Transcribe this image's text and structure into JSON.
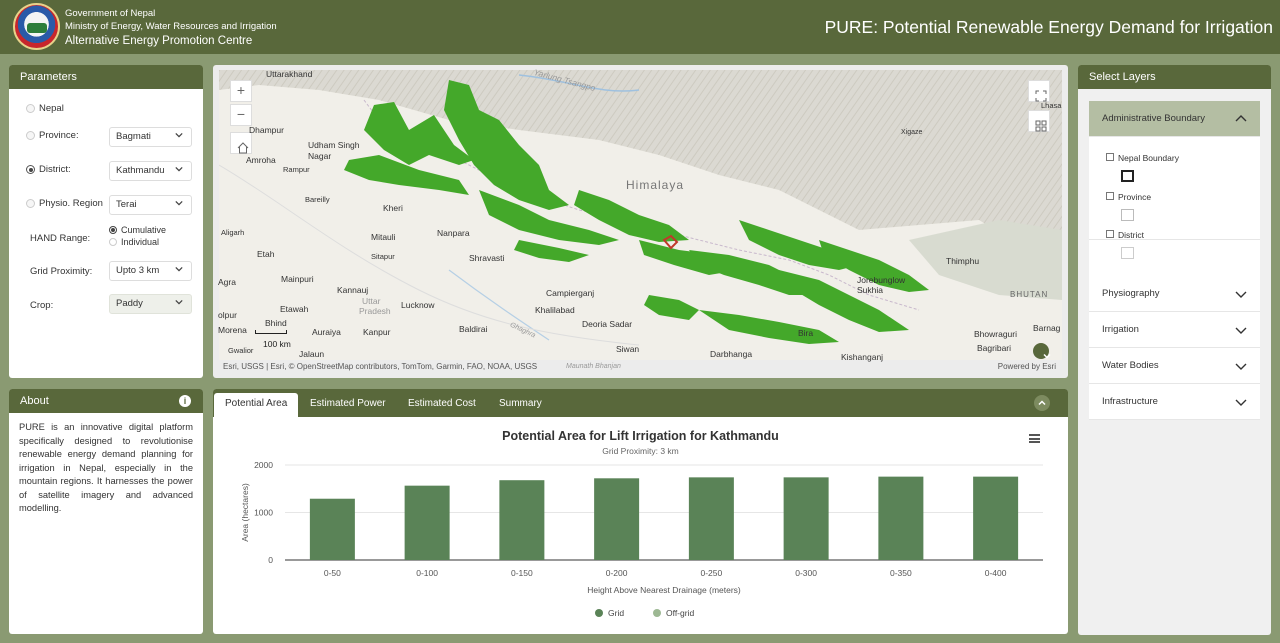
{
  "header": {
    "gov_line1": "Government of Nepal",
    "gov_line2": "Ministry of Energy, Water Resources and Irrigation",
    "gov_line3": "Alternative Energy Promotion Centre",
    "app_title": "PURE: Potential Renewable Energy Demand for Irrigation"
  },
  "parameters": {
    "title": "Parameters",
    "nepal_label": "Nepal",
    "province_label": "Province:",
    "province_value": "Bagmati",
    "district_label": "District:",
    "district_value": "Kathmandu",
    "physio_label": "Physio. Region",
    "physio_value": "Terai",
    "hand_label": "HAND Range:",
    "hand_opt1": "Cumulative",
    "hand_opt2": "Individual",
    "grid_label": "Grid Proximity:",
    "grid_value": "Upto 3 km",
    "crop_label": "Crop:",
    "crop_value": "Paddy"
  },
  "about": {
    "title": "About",
    "text": "PURE is an innovative digital platform specifically designed to revolutionise renewable energy demand planning for irrigation in Nepal, especially in the mountain regions. It harnesses the power of satellite imagery and advanced modelling."
  },
  "map": {
    "attribution": "Esri, USGS | Esri, © OpenStreetMap contributors, TomTom, Garmin, FAO, NOAA, USGS",
    "powered_by": "Powered by Esri",
    "scale_label": "100 km",
    "labels": {
      "uttarakhand": "Uttarakhand",
      "dhampur": "Dhampur",
      "udham": "Udham Singh",
      "nagar": "Nagar",
      "amroha": "Amroha",
      "rampur": "Rampur",
      "bareilly": "Bareilly",
      "aligarh": "Aligarh",
      "kheri": "Kheri",
      "mitauli": "Mitauli",
      "nanpara": "Nanpara",
      "shravasti": "Shravasti",
      "sitapur": "Sitapur",
      "etah": "Etah",
      "agra": "Agra",
      "mainpuri": "Mainpuri",
      "kannauj": "Kannauj",
      "uttar": "Uttar",
      "pradesh": "Pradesh",
      "lucknow": "Lucknow",
      "etawah": "Etawah",
      "dholpur": "olpur",
      "bhind": "Bhind",
      "morena": "Morena",
      "gwalior": "Gwalior",
      "auraiya": "Auraiya",
      "kanpur": "Kanpur",
      "jalaun": "Jalaun",
      "baldirai": "Baldirai",
      "campierganj": "Campierganj",
      "khalilabad": "Khalilabad",
      "deoria": "Deoria Sadar",
      "siwan": "Siwan",
      "darbhanga": "Darbhanga",
      "maunath": "Maunath Bhanjan",
      "himalaya": "Himalaya",
      "jorebunglow": "Jorebunglow",
      "sukhia": "Sukhia",
      "thimphu": "Thimphu",
      "bhutan": "BHUTAN",
      "lhasa": "Lhasa",
      "xigaze": "Xigaze",
      "kishanganj": "Kishanganj",
      "bhowraguri": "Bhowraguri",
      "bagribari": "Bagribari",
      "barnag": "Barnag",
      "yarlung": "Yarlung Tsangpo",
      "ghaghra": "Ghaghra",
      "birat": "Bira"
    }
  },
  "chart_panel": {
    "tabs": [
      "Potential Area",
      "Estimated Power",
      "Estimated Cost",
      "Summary"
    ],
    "active_tab": 0
  },
  "chart_data": {
    "type": "bar",
    "title": "Potential Area for Lift Irrigation for Kathmandu",
    "subtitle": "Grid Proximity: 3 km",
    "xlabel": "Height Above Nearest Drainage (meters)",
    "ylabel": "Area (hectares)",
    "categories": [
      "0-50",
      "0-100",
      "0-150",
      "0-200",
      "0-250",
      "0-300",
      "0-350",
      "0-400"
    ],
    "series": [
      {
        "name": "Grid",
        "color": "#5a8357",
        "values": [
          1290,
          1565,
          1680,
          1720,
          1740,
          1740,
          1755,
          1755
        ]
      },
      {
        "name": "Off-grid",
        "color": "#9db893",
        "values": [
          0,
          0,
          0,
          0,
          0,
          0,
          0,
          0
        ]
      }
    ],
    "yticks": [
      0,
      1000,
      2000
    ],
    "ylim": [
      0,
      2000
    ],
    "legend": "bottom-center",
    "grid": true
  },
  "layers": {
    "title": "Select Layers",
    "admin_title": "Administrative Boundary",
    "nepal_boundary": "Nepal Boundary",
    "province": "Province",
    "district": "District",
    "physiography": "Physiography",
    "irrigation": "Irrigation",
    "water_bodies": "Water Bodies",
    "infrastructure": "Infrastructure"
  },
  "colors": {
    "header": "#59683b",
    "background": "#8a9a72",
    "green_layer": "#44a82a",
    "bar": "#5a8357"
  }
}
